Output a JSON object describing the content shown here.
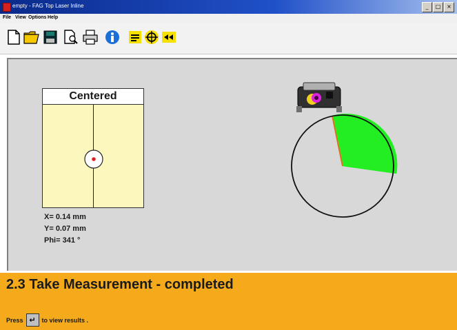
{
  "window": {
    "title": "empty - FAG Top Laser Inline",
    "minimize_label": "_",
    "maximize_label": "□",
    "close_label": "×"
  },
  "menu": {
    "items": [
      "File",
      "View",
      "Options",
      "Help"
    ]
  },
  "toolbar": {
    "icons": [
      "new-file-icon",
      "open-folder-icon",
      "save-disk-icon",
      "print-preview-icon",
      "printer-icon",
      "info-icon",
      "dimensions-icon",
      "target-icon",
      "alignment-icon"
    ],
    "accent_colors": {
      "info": "#1a6fd8",
      "yellow": "#f5e000"
    }
  },
  "target_view": {
    "status_label": "Centered",
    "x_reading": "X= 0.14 mm",
    "y_reading": "Y= 0.07 mm",
    "phi_reading": "Phi= 341 °",
    "phi_degrees": 341,
    "panel_color": "#fbf7bd",
    "dot_color": "#e02020"
  },
  "dial": {
    "sector_color": "#22ee22",
    "sector_border_color": "#e07020",
    "sensor_lens_color": "#e020e0"
  },
  "status": {
    "title": "2.3 Take Measurement - completed",
    "hint_prefix": "Press",
    "enter_key_symbol": "↵",
    "hint_suffix": "to view results .",
    "background_color": "#f5aa1c"
  }
}
